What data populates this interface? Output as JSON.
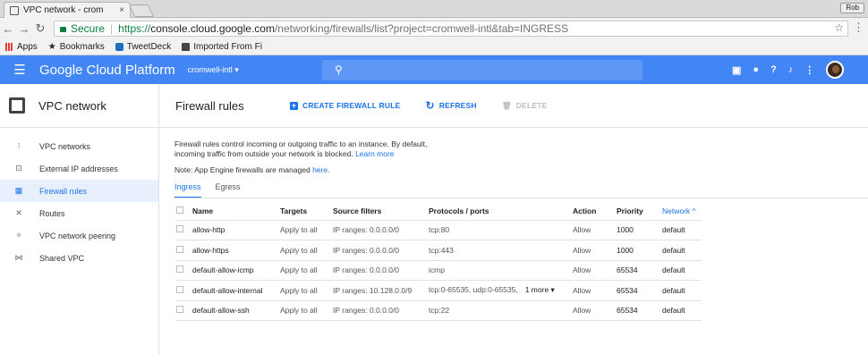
{
  "browser": {
    "tab_title": "VPC network - crom",
    "tab_close": "×",
    "user_chip": "Rob",
    "url": {
      "secure_label": "Secure",
      "scheme": "https://",
      "host": "console.cloud.google.com",
      "path": "/networking/firewalls/list?project=cromwell-intl&tab=INGRESS"
    },
    "bookmarks": [
      "Apps",
      "Bookmarks",
      "TweetDeck",
      "Imported From Fi"
    ]
  },
  "appbar": {
    "product": "Google Cloud Platform",
    "project": "cromwell-intl ▾"
  },
  "sidebar": {
    "title": "VPC network",
    "items": [
      {
        "label": "VPC networks",
        "icon": "⁝"
      },
      {
        "label": "External IP addresses",
        "icon": "⊡"
      },
      {
        "label": "Firewall rules",
        "icon": "▦"
      },
      {
        "label": "Routes",
        "icon": "✕"
      },
      {
        "label": "VPC network peering",
        "icon": "✧"
      },
      {
        "label": "Shared VPC",
        "icon": "⋈"
      }
    ]
  },
  "header": {
    "title": "Firewall rules",
    "create": "CREATE FIREWALL RULE",
    "refresh": "REFRESH",
    "delete": "DELETE"
  },
  "description": {
    "line1": "Firewall rules control incoming or outgoing traffic to an instance. By default,",
    "line2": "incoming traffic from outside your network is blocked.",
    "learn_more": "Learn more",
    "note": "Note: App Engine firewalls are managed",
    "note_link": "here."
  },
  "tabs": [
    "Ingress",
    "Egress"
  ],
  "table": {
    "columns": [
      "Name",
      "Targets",
      "Source filters",
      "Protocols / ports",
      "Action",
      "Priority",
      "Network ^"
    ],
    "rows": [
      {
        "name": "allow-http",
        "targets": "Apply to all",
        "source": "IP ranges: 0.0.0.0/0",
        "protocols": "tcp:80",
        "more": "",
        "action": "Allow",
        "priority": "1000",
        "network": "default"
      },
      {
        "name": "allow-https",
        "targets": "Apply to all",
        "source": "IP ranges: 0.0.0.0/0",
        "protocols": "tcp:443",
        "more": "",
        "action": "Allow",
        "priority": "1000",
        "network": "default"
      },
      {
        "name": "default-allow-icmp",
        "targets": "Apply to all",
        "source": "IP ranges: 0.0.0.0/0",
        "protocols": "icmp",
        "more": "",
        "action": "Allow",
        "priority": "65534",
        "network": "default"
      },
      {
        "name": "default-allow-internal",
        "targets": "Apply to all",
        "source": "IP ranges: 10.128.0.0/9",
        "protocols": "tcp:0-65535, udp:0-65535,",
        "more": "1 more ▾",
        "action": "Allow",
        "priority": "65534",
        "network": "default"
      },
      {
        "name": "default-allow-ssh",
        "targets": "Apply to all",
        "source": "IP ranges: 0.0.0.0/0",
        "protocols": "tcp:22",
        "more": "",
        "action": "Allow",
        "priority": "65534",
        "network": "default"
      }
    ]
  },
  "colors": {
    "brand": "#4285f4",
    "accent": "#1a73e8",
    "secure": "#0b8043"
  }
}
